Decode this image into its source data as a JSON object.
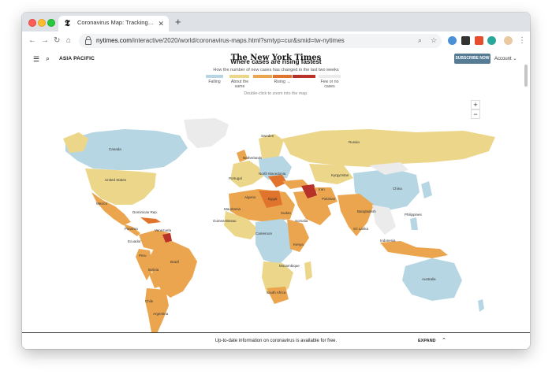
{
  "browser": {
    "tab_title": "Coronavirus Map: Tracking the",
    "tab_favicon": "𝕿",
    "url_host": "nytimes.com",
    "url_path": "/interactive/2020/world/coronavirus-maps.html?smtyp=cur&smid=tw-nytimes"
  },
  "header": {
    "section": "ASIA PACIFIC",
    "logo": "The New York Times",
    "subscribe": "SUBSCRIBE NOW",
    "account": "Account"
  },
  "map": {
    "headline": "Where cases are rising fastest",
    "subhead": "How the number of new cases has changed in the last two weeks",
    "legend": {
      "falling": "Falling",
      "about_same": "About the same",
      "rising": "Rising →",
      "few": "Few or no cases"
    },
    "hint": "Double-click to zoom into the map.",
    "zoom_in": "+",
    "zoom_out": "−",
    "labels": {
      "canada": "Canada",
      "united_states": "United States",
      "mexico": "Mexico",
      "dominican_rep": "Dominican Rep.",
      "panama": "Panama",
      "venezuela": "Venezuela",
      "ecuador": "Ecuador",
      "peru": "Peru",
      "brazil": "Brazil",
      "bolivia": "Bolivia",
      "chile": "Chile",
      "argentina": "Argentina",
      "russia": "Russia",
      "sweden": "Sweden",
      "netherlands": "Netherlands",
      "portugal": "Portugal",
      "north_macedonia": "North Macedonia",
      "algeria": "Algeria",
      "egypt": "Egypt",
      "mauritania": "Mauritania",
      "guinea_bissau": "Guinea-Bissau",
      "sudan": "Sudan",
      "cameroon": "Cameroon",
      "somalia": "Somalia",
      "kenya": "Kenya",
      "mozambique": "Mozambique",
      "south_africa": "South Africa",
      "iran": "Iran",
      "pakistan": "Pakistan",
      "kyrgyzstan": "Kyrgyzstan",
      "china": "China",
      "bangladesh": "Bangladesh",
      "sri_lanka": "Sri Lanka",
      "philippines": "Philippines",
      "indonesia": "Indonesia",
      "australia": "Australia"
    }
  },
  "bottom": {
    "text": "Up-to-date information on coronavirus is available for free.",
    "expand": "EXPAND"
  },
  "colors": {
    "falling": "#b6d6e3",
    "about_same": "#ecd68a",
    "rising_low": "#eba54f",
    "rising_mid": "#e0742c",
    "rising_high": "#b8322a",
    "few": "#ebebeb"
  }
}
